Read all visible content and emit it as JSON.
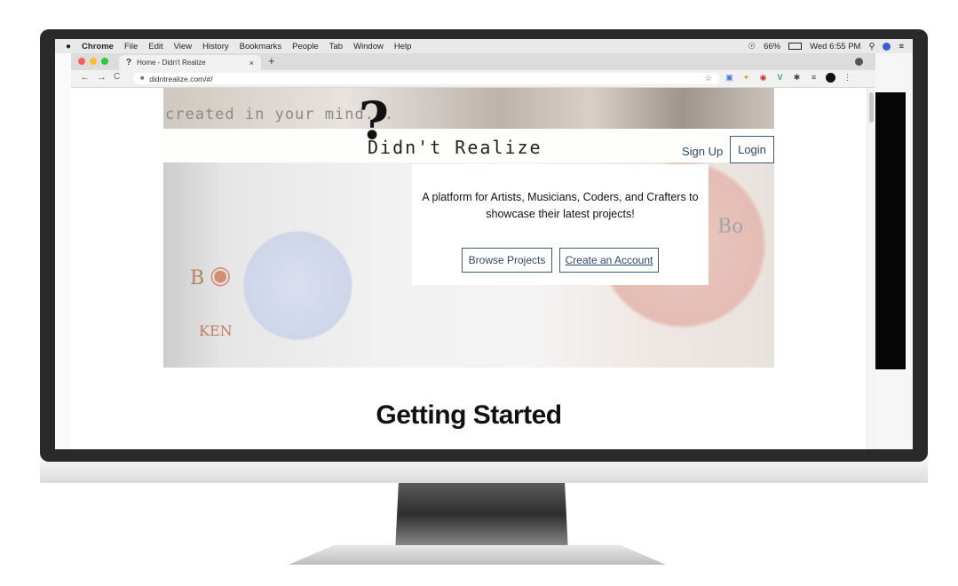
{
  "menubar": {
    "app": "Chrome",
    "items": [
      "File",
      "Edit",
      "View",
      "History",
      "Bookmarks",
      "People",
      "Tab",
      "Window",
      "Help"
    ],
    "battery": "66%",
    "clock": "Wed 6:55 PM",
    "icons": [
      "apple-icon",
      "wifi-icon",
      "battery-icon",
      "spotlight-icon",
      "siri-icon",
      "notification-center-icon"
    ]
  },
  "tab": {
    "favicon": "?",
    "title": "Home - Didn't Realize",
    "close": "×",
    "new_tab": "+"
  },
  "toolbar": {
    "back": "←",
    "forward": "→",
    "reload": "C",
    "url": "didntrealize.com/#/",
    "bookmark": "☆",
    "menu": "⋮"
  },
  "site": {
    "tagline": "created in your mind...",
    "logo_mark": "?",
    "logo_text": "Didn't Realize",
    "signup": "Sign Up",
    "login": "Login",
    "description": "A platform for Artists, Musicians, Coders, and Crafters to showcase their latest projects!",
    "browse_button": "Browse Projects",
    "create_button": "Create an Account",
    "section_heading": "Getting Started"
  },
  "colors": {
    "accent": "#2c4a6b",
    "bezel": "#2a2a2a"
  }
}
